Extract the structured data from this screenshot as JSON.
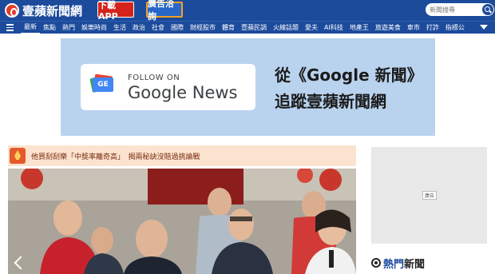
{
  "header": {
    "logo_text": "壹蘋新聞網",
    "app_button": "下載APP",
    "ad_button": "廣告洽詢",
    "search_placeholder": "新聞搜尋"
  },
  "nav": {
    "items": [
      {
        "label": "最新",
        "active": true
      },
      {
        "label": "焦點"
      },
      {
        "label": "熱門"
      },
      {
        "label": "娛樂時尚"
      },
      {
        "label": "生活"
      },
      {
        "label": "政治"
      },
      {
        "label": "社會"
      },
      {
        "label": "國際"
      },
      {
        "label": "財經股市"
      },
      {
        "label": "體育"
      },
      {
        "label": "壹蘋民調"
      },
      {
        "label": "火線話題"
      },
      {
        "label": "愛夫"
      },
      {
        "label": "AI科技"
      },
      {
        "label": "地產王"
      },
      {
        "label": "旅遊美食"
      },
      {
        "label": "車市"
      },
      {
        "label": "打詐"
      },
      {
        "label": "指標公"
      }
    ]
  },
  "banner": {
    "follow_on": "FOLLOW ON",
    "google_news": "Google News",
    "logo_letters": "GE",
    "line1": "從《Google 新聞》",
    "line2": "追蹤壹蘋新聞網"
  },
  "headline": {
    "text": "他買刮刮樂「中獎率離奇高」　揭兩秘訣沒賠過挑論戰"
  },
  "side_ad": {
    "tag": "廣告"
  },
  "hot_news": {
    "label_a": "熱門",
    "label_b": "新聞"
  },
  "colors": {
    "brand_blue": "#1c4b9c",
    "app_red": "#d4231a",
    "banner_bg": "#b9d3ef",
    "headline_bg": "#fbe3cf"
  }
}
